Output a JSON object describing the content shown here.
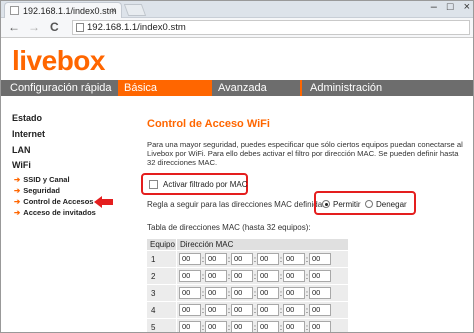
{
  "browser": {
    "tab_title": "192.168.1.1/index0.stm",
    "tab_close": "×",
    "url": "192.168.1.1/index0.stm",
    "back": "←",
    "forward": "→",
    "reload": "C",
    "win_min": "–",
    "win_max": "□",
    "win_close": "×"
  },
  "brand": {
    "logo": "livebox",
    "accent": "#ff6600"
  },
  "menu": {
    "items": [
      "Configuración rápida",
      "Básica",
      "Avanzada",
      "Administración"
    ],
    "active": "Básica"
  },
  "sidebar": {
    "sections": [
      "Estado",
      "Internet",
      "LAN",
      "WiFi"
    ],
    "wifi_items": [
      "SSID y Canal",
      "Seguridad",
      "Control de Accesos",
      "Acceso de invitados"
    ],
    "arrow": "➔"
  },
  "content": {
    "title": "Control de Acceso WiFi",
    "description": "Para una mayor seguridad, puedes especificar que sólo ciertos equipos puedan conectarse al Livebox por WiFi. Para ello debes activar el filtro por dirección MAC. Se pueden definir hasta 32 direcciones MAC.",
    "filter_checkbox_label": "Activar filtrado por MAC",
    "rule_label": "Regla a seguir para las direcciones MAC definidas:",
    "radio_permit": "Permitir",
    "radio_deny": "Denegar",
    "table_caption": "Tabla de direcciones MAC (hasta 32 equipos):",
    "table_headers": [
      "Equipo",
      "Dirección MAC"
    ],
    "rows": [
      {
        "num": "1",
        "octets": [
          "00",
          "00",
          "00",
          "00",
          "00",
          "00"
        ]
      },
      {
        "num": "2",
        "octets": [
          "00",
          "00",
          "00",
          "00",
          "00",
          "00"
        ]
      },
      {
        "num": "3",
        "octets": [
          "00",
          "00",
          "00",
          "00",
          "00",
          "00"
        ]
      },
      {
        "num": "4",
        "octets": [
          "00",
          "00",
          "00",
          "00",
          "00",
          "00"
        ]
      },
      {
        "num": "5",
        "octets": [
          "00",
          "00",
          "00",
          "00",
          "00",
          "00"
        ]
      }
    ],
    "colon": ":"
  }
}
